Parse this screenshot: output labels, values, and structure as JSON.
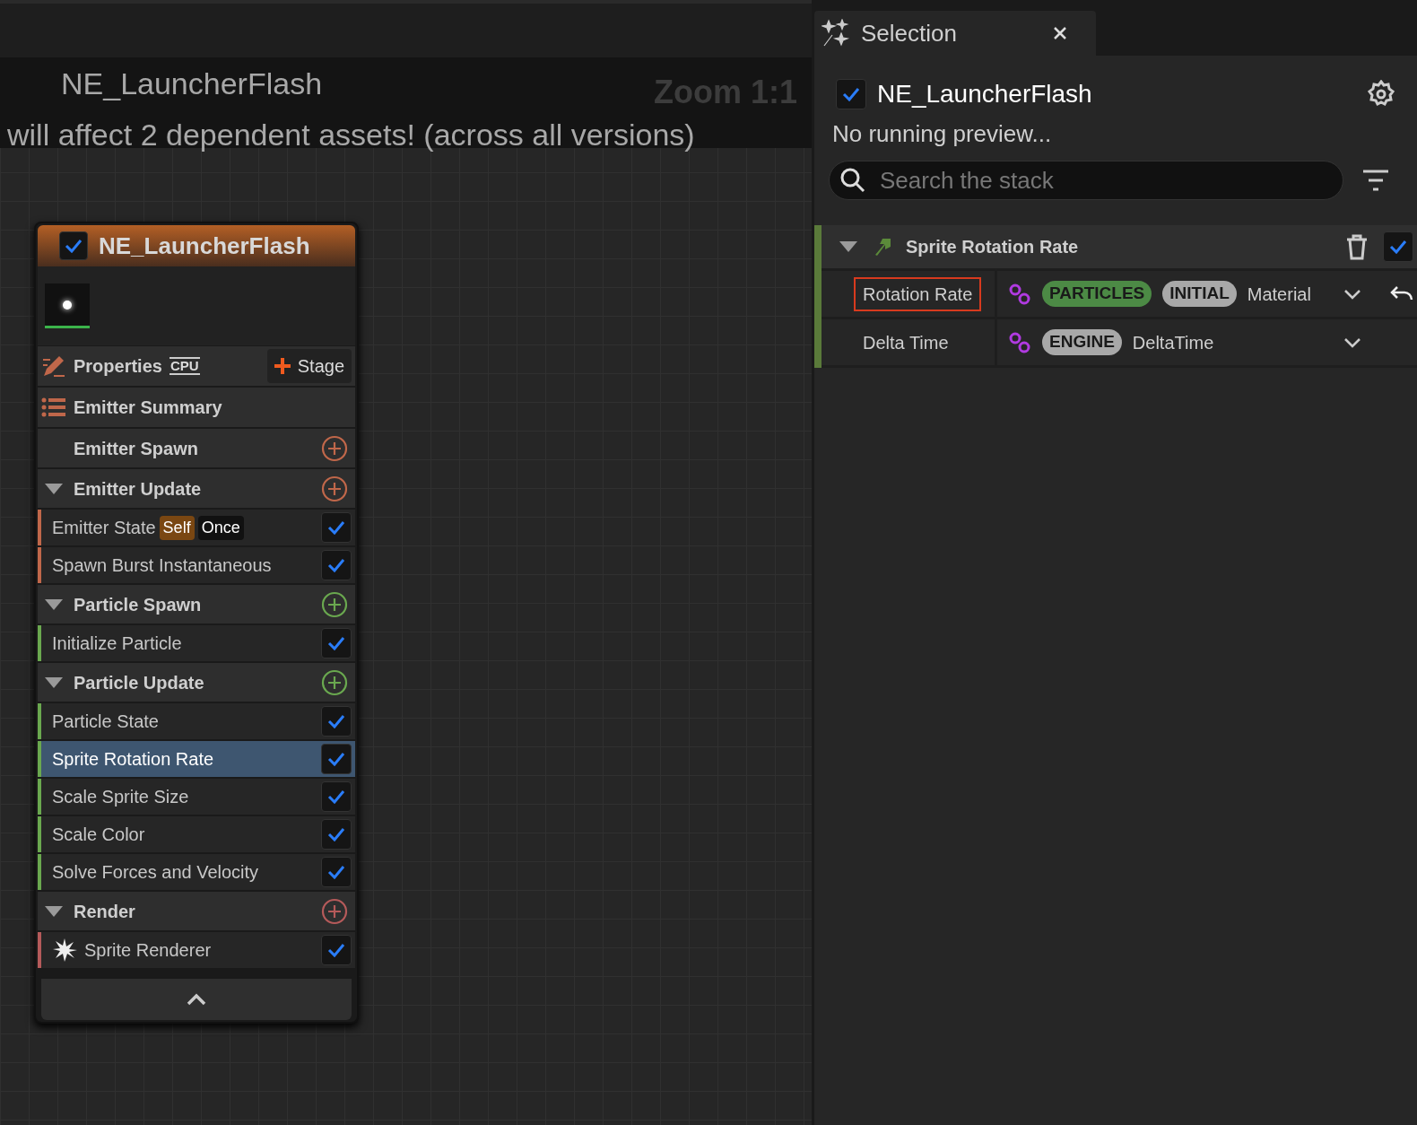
{
  "banner": {
    "title": "NE_LauncherFlash",
    "message": "will affect 2 dependent assets! (across all versions)",
    "zoom": "Zoom 1:1"
  },
  "node": {
    "title": "NE_LauncherFlash",
    "enabled": true,
    "properties_label": "Properties",
    "cpu_label": "CPU",
    "stage_button": "Stage",
    "sections": [
      {
        "kind": "summary",
        "label": "Emitter Summary"
      },
      {
        "kind": "group",
        "label": "Emitter Spawn",
        "color": "#c0674a"
      },
      {
        "kind": "group",
        "label": "Emitter Update",
        "color": "#c0674a",
        "items": [
          {
            "label": "Emitter State",
            "enabled": true,
            "selected": false,
            "tags": [
              {
                "label": "Self",
                "color": "#7a4712"
              },
              {
                "label": "Once",
                "color": "#111111"
              }
            ]
          },
          {
            "label": "Spawn Burst Instantaneous",
            "enabled": true,
            "selected": false
          }
        ]
      },
      {
        "kind": "group",
        "label": "Particle Spawn",
        "color": "#6aa84f",
        "items": [
          {
            "label": "Initialize Particle",
            "enabled": true,
            "selected": false
          }
        ]
      },
      {
        "kind": "group",
        "label": "Particle Update",
        "color": "#6aa84f",
        "items": [
          {
            "label": "Particle State",
            "enabled": true,
            "selected": false
          },
          {
            "label": "Sprite Rotation Rate",
            "enabled": true,
            "selected": true
          },
          {
            "label": "Scale Sprite Size",
            "enabled": true,
            "selected": false
          },
          {
            "label": "Scale Color",
            "enabled": true,
            "selected": false
          },
          {
            "label": "Solve Forces and Velocity",
            "enabled": true,
            "selected": false
          }
        ]
      },
      {
        "kind": "group",
        "label": "Render",
        "color": "#b55a5a",
        "items": [
          {
            "label": "Sprite Renderer",
            "enabled": true,
            "selected": false,
            "renderer": true
          }
        ]
      }
    ]
  },
  "panel": {
    "tab": "Selection",
    "title": "NE_LauncherFlash",
    "enabled": true,
    "status": "No running preview...",
    "search": {
      "placeholder": "Search the stack"
    },
    "module": {
      "title": "Sprite Rotation Rate",
      "expanded": true,
      "enabled": true,
      "inputs": [
        {
          "label": "Rotation Rate",
          "highlighted": true,
          "badges": [
            {
              "label": "PARTICLES",
              "color": "#4c8a45"
            },
            {
              "label": "INITIAL",
              "color": "#a8a8a8"
            }
          ],
          "value": "Material",
          "reset": true
        },
        {
          "label": "Delta Time",
          "highlighted": false,
          "badges": [
            {
              "label": "ENGINE",
              "color": "#a8a8a8"
            }
          ],
          "value": "DeltaTime",
          "reset": false
        }
      ]
    }
  }
}
